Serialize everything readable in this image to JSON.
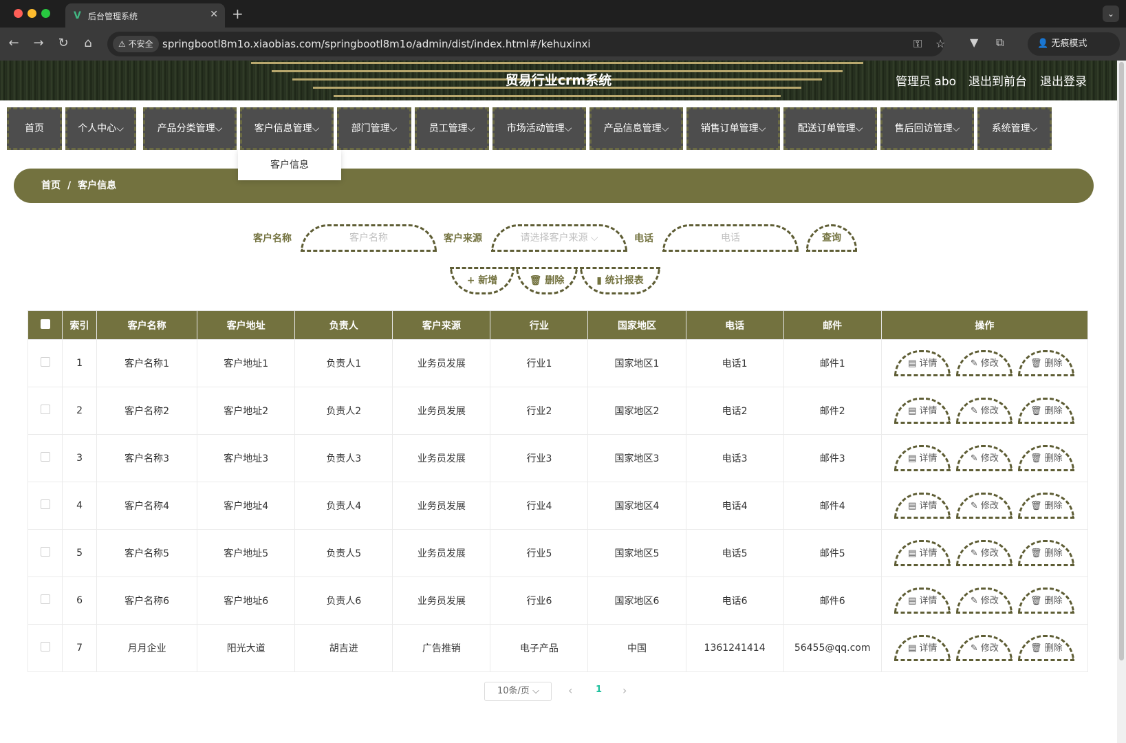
{
  "browser": {
    "tab_title": "后台管理系统",
    "tab_icon": "V",
    "insecure_label": "不安全",
    "url": "springbootl8m1o.xiaobias.com/springbootl8m1o/admin/dist/index.html#/kehuxinxi",
    "incognito_label": "无痕模式"
  },
  "header": {
    "title": "贸易行业crm系统",
    "user": "管理员 abo",
    "to_front": "退出到前台",
    "logout": "退出登录"
  },
  "nav": {
    "items": [
      "首页",
      "个人中心",
      "产品分类管理",
      "客户信息管理",
      "部门管理",
      "员工管理",
      "市场活动管理",
      "产品信息管理",
      "销售订单管理",
      "配送订单管理",
      "售后回访管理",
      "系统管理"
    ],
    "dropdown_item": "客户信息"
  },
  "breadcrumb": {
    "home": "首页",
    "separator": "/",
    "current": "客户信息"
  },
  "search": {
    "name_label": "客户名称",
    "name_placeholder": "客户名称",
    "source_label": "客户来源",
    "source_placeholder": "请选择客户来源",
    "phone_label": "电话",
    "phone_placeholder": "电话",
    "query_button": "查询"
  },
  "actions": {
    "add": "新增",
    "delete": "删除",
    "report": "统计报表"
  },
  "table": {
    "headers": [
      "索引",
      "客户名称",
      "客户地址",
      "负责人",
      "客户来源",
      "行业",
      "国家地区",
      "电话",
      "邮件",
      "操作"
    ],
    "rows": [
      [
        "1",
        "客户名称1",
        "客户地址1",
        "负责人1",
        "业务员发展",
        "行业1",
        "国家地区1",
        "电话1",
        "邮件1"
      ],
      [
        "2",
        "客户名称2",
        "客户地址2",
        "负责人2",
        "业务员发展",
        "行业2",
        "国家地区2",
        "电话2",
        "邮件2"
      ],
      [
        "3",
        "客户名称3",
        "客户地址3",
        "负责人3",
        "业务员发展",
        "行业3",
        "国家地区3",
        "电话3",
        "邮件3"
      ],
      [
        "4",
        "客户名称4",
        "客户地址4",
        "负责人4",
        "业务员发展",
        "行业4",
        "国家地区4",
        "电话4",
        "邮件4"
      ],
      [
        "5",
        "客户名称5",
        "客户地址5",
        "负责人5",
        "业务员发展",
        "行业5",
        "国家地区5",
        "电话5",
        "邮件5"
      ],
      [
        "6",
        "客户名称6",
        "客户地址6",
        "负责人6",
        "业务员发展",
        "行业6",
        "国家地区6",
        "电话6",
        "邮件6"
      ],
      [
        "7",
        "月月企业",
        "阳光大道",
        "胡吉进",
        "广告推销",
        "电子产品",
        "中国",
        "1361241414",
        "56455@qq.com"
      ]
    ],
    "row_actions": {
      "detail": "详情",
      "edit": "修改",
      "delete": "删除"
    }
  },
  "pagination": {
    "page_size": "10条/页",
    "current_page": "1"
  },
  "colors": {
    "accent": "#73723f",
    "nav_bg": "#4d4d4d",
    "active_page": "#1cbf9c"
  }
}
